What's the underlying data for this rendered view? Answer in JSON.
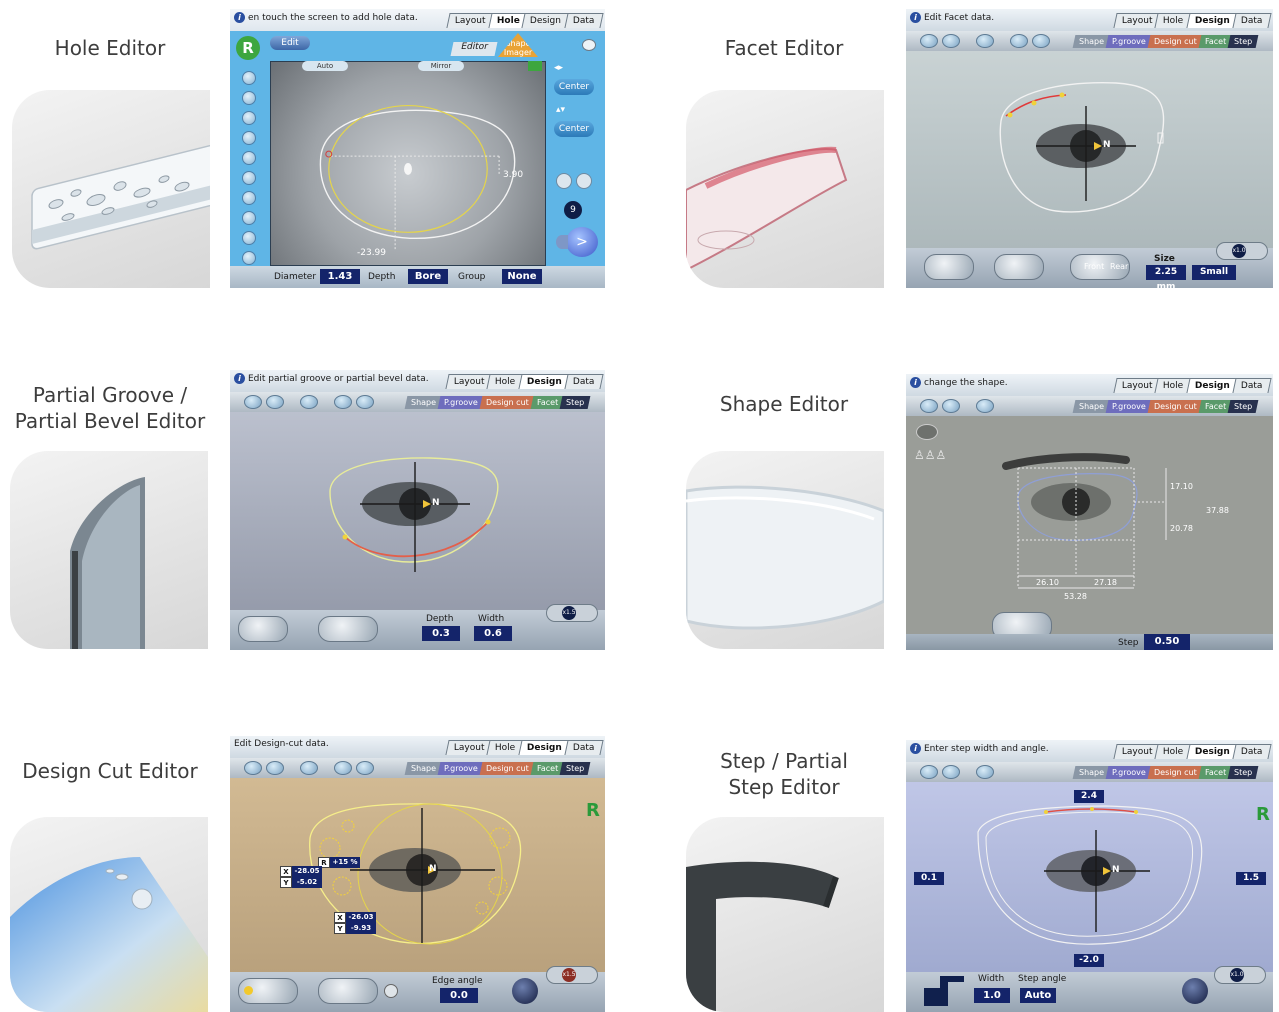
{
  "tabs": [
    "Layout",
    "Hole",
    "Design",
    "Data"
  ],
  "editor_subtabs": [
    "Shape",
    "P.groove",
    "Design cut",
    "Facet",
    "Step"
  ],
  "features": [
    {
      "title": "Hole Editor",
      "screen": {
        "hint": "en touch the screen to add hole data.",
        "active_tab": "Hole",
        "edit_button": "Edit",
        "editor_tab": "Editor",
        "shape_imager_tab": "Shape Imager",
        "auto_button": "Auto",
        "mirror_button": "Mirror",
        "center_button_1": "Center",
        "center_button_2": "Center",
        "count_badge": "9",
        "next_button": ">",
        "badge": "R",
        "dim_right": "3.90",
        "dim_bottom": "-23.99",
        "fields": [
          {
            "label": "Diameter",
            "value": "1.43"
          },
          {
            "label": "Depth",
            "value": "Bore"
          },
          {
            "label": "Group",
            "value": "None"
          }
        ]
      }
    },
    {
      "title": "Facet Editor",
      "screen": {
        "hint": "Edit Facet data.",
        "active_tab": "Design",
        "active_subtab": "Facet",
        "eye_label": "N",
        "toggle_front": "Front",
        "toggle_rear": "Rear",
        "size_label": "Size",
        "size_value": "2.25 mm",
        "size_option": "Small",
        "zoom": "x1.0"
      }
    },
    {
      "title": "Partial Groove / Partial Bevel Editor",
      "screen": {
        "hint": "Edit partial groove or partial bevel data.",
        "active_tab": "Design",
        "active_subtab": "P.groove",
        "eye_label": "N",
        "depth_label": "Depth",
        "depth_value": "0.3",
        "width_label": "Width",
        "width_value": "0.6",
        "zoom": "x1.5"
      }
    },
    {
      "title": "Shape Editor",
      "screen": {
        "hint": "change the shape.",
        "active_tab": "Design",
        "active_subtab": "Shape",
        "dims": [
          "17.10",
          "37.88",
          "20.78",
          "26.10",
          "27.18",
          "53.28"
        ],
        "step_label": "Step",
        "step_value": "0.50"
      }
    },
    {
      "title": "Design Cut Editor",
      "screen": {
        "hint": "Edit Design-cut data.",
        "active_tab": "Design",
        "active_subtab": "Design cut",
        "eye_label": "N",
        "badge": "R",
        "r_label": "R",
        "r_value": "+15 %",
        "x1_label": "X",
        "x1_value": "-28.05",
        "y1_label": "Y",
        "y1_value": "-5.02",
        "x2_label": "X",
        "x2_value": "-26.03",
        "y2_label": "Y",
        "y2_value": "-9.93",
        "edge_label": "Edge angle",
        "edge_value": "0.0",
        "zoom": "x1.5"
      }
    },
    {
      "title": "Step / Partial Step Editor",
      "screen": {
        "hint": "Enter step width and angle.",
        "active_tab": "Design",
        "active_subtab": "Step",
        "eye_label": "N",
        "badge": "R",
        "top_value": "2.4",
        "left_value": "0.1",
        "right_value": "1.5",
        "bottom_value": "-2.0",
        "width_label": "Width",
        "width_value": "1.0",
        "angle_label": "Step angle",
        "angle_value": "Auto",
        "zoom": "x1.0"
      }
    }
  ],
  "colors": {
    "navy_value": "#14246a",
    "hole_bg": "#5fb5e6",
    "facet_bg": "#b7c3c7",
    "groove_bg": "#a7adbd",
    "shape_bg": "#9a9d98",
    "design_bg": "#c9ad86",
    "step_bg": "#aab4d4"
  }
}
